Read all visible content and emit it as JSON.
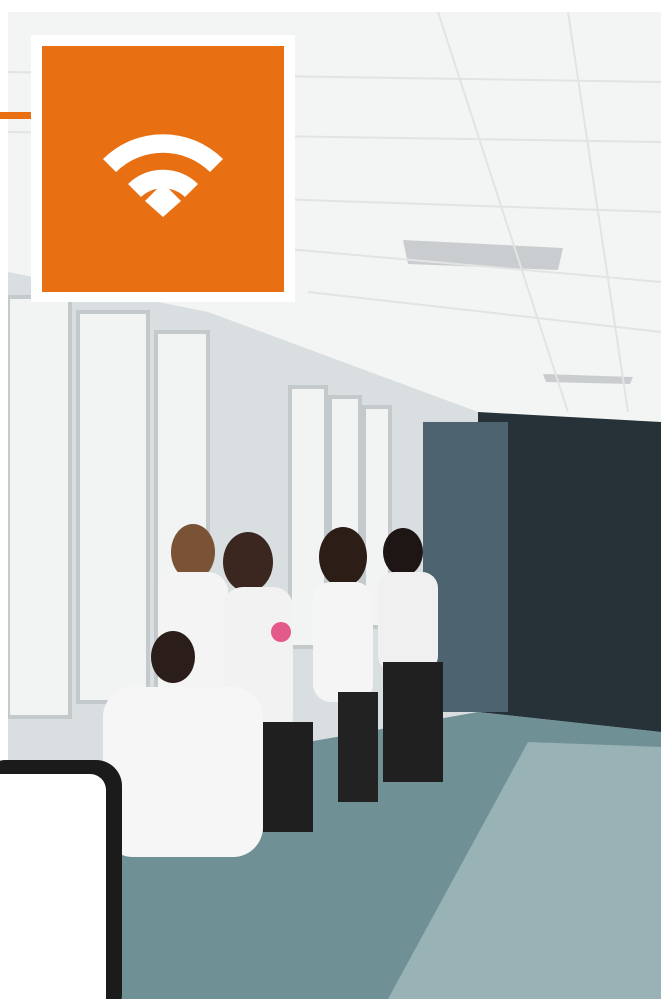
{
  "badge": {
    "icon": "wifi-icon",
    "color": "#e86f12",
    "frame_color": "#ffffff"
  },
  "photo": {
    "subject": "hallway-with-students-in-lab-coats"
  },
  "device": {
    "icon": "tablet-icon"
  },
  "colors": {
    "accent": "#e86f12",
    "device_bezel": "#1b1b1b"
  }
}
